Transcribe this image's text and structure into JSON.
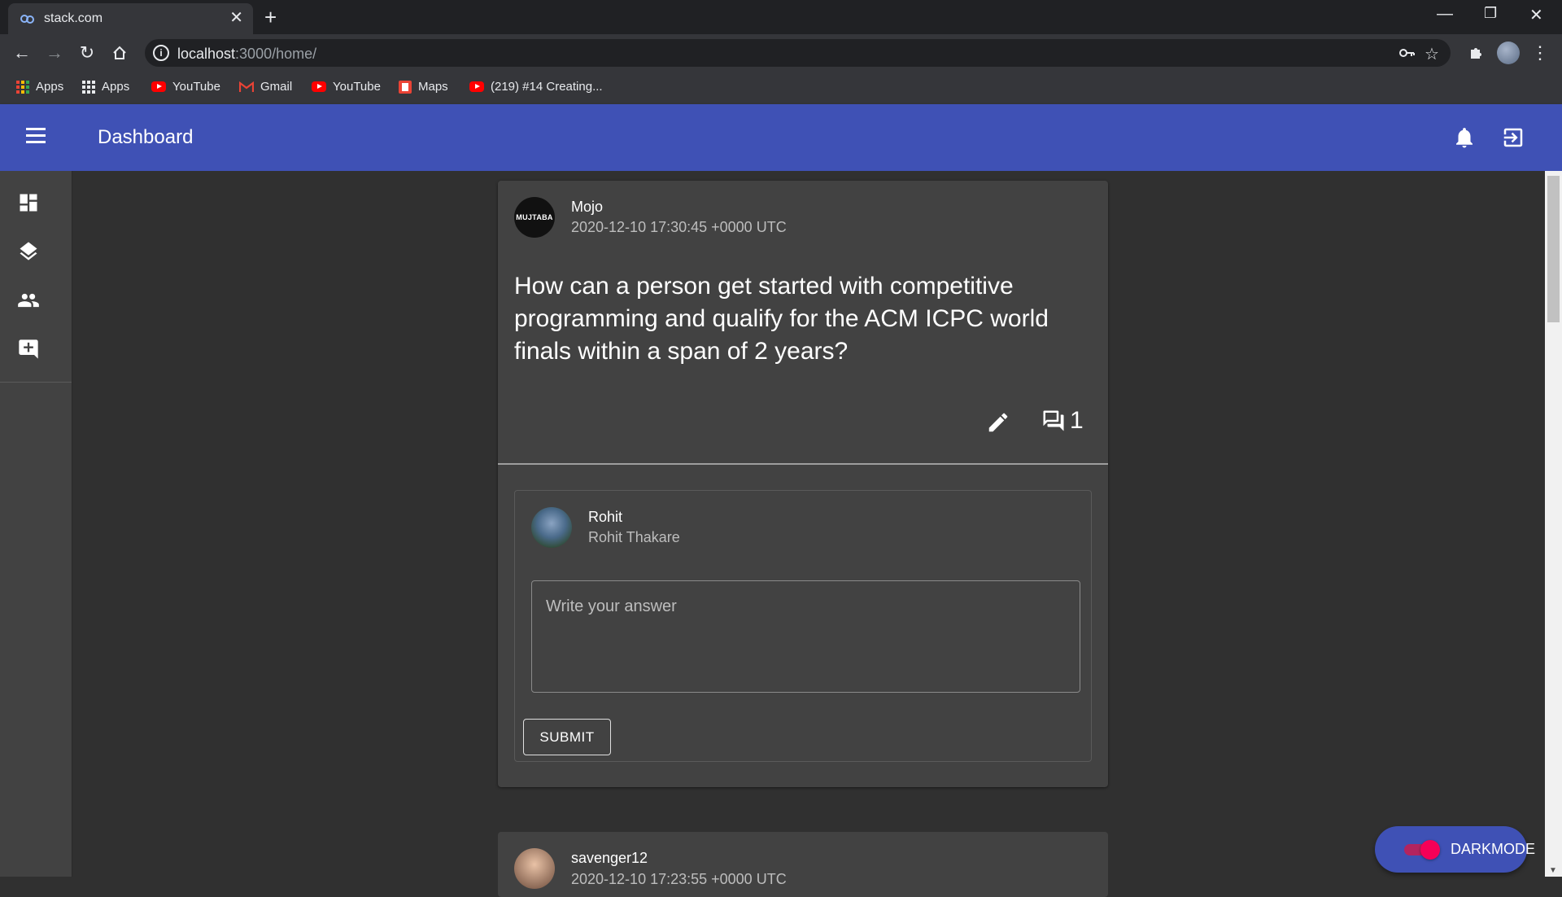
{
  "browser": {
    "tab_title": "stack.com",
    "tab_close": "✕",
    "new_tab": "+",
    "url_host": "localhost",
    "url_path": ":3000/home/",
    "bookmarks": [
      {
        "label": "Apps",
        "icon": "apps-grid-icon"
      },
      {
        "label": "Apps",
        "icon": "apps-grid-icon"
      },
      {
        "label": "YouTube",
        "icon": "youtube-icon"
      },
      {
        "label": "Gmail",
        "icon": "gmail-icon"
      },
      {
        "label": "YouTube",
        "icon": "youtube-icon"
      },
      {
        "label": "Maps",
        "icon": "maps-icon"
      },
      {
        "label": "(219) #14 Creating...",
        "icon": "youtube-icon"
      }
    ]
  },
  "appbar": {
    "title": "Dashboard",
    "color": "#3f51b5"
  },
  "sidebar": {
    "items": [
      {
        "name": "dashboard",
        "icon": "dashboard-icon"
      },
      {
        "name": "layers",
        "icon": "layers-icon"
      },
      {
        "name": "people",
        "icon": "people-icon"
      },
      {
        "name": "add-comment",
        "icon": "add-comment-icon"
      }
    ]
  },
  "question": {
    "avatar_text": "MUJTABA",
    "author": "Mojo",
    "date": "2020-12-10 17:30:45 +0000 UTC",
    "text": "How can a person get started with competitive programming and qualify for the ACM ICPC world finals within a span of 2 years?",
    "comment_count": "1"
  },
  "answer_form": {
    "user_name": "Rohit",
    "user_fullname": "Rohit Thakare",
    "placeholder": "Write your answer",
    "submit_label": "SUBMIT"
  },
  "next_question": {
    "author": "savenger12",
    "date": "2020-12-10 17:23:55 +0000 UTC"
  },
  "darkmode": {
    "label": "DARKMODE",
    "enabled": true,
    "accent": "#f50057"
  }
}
